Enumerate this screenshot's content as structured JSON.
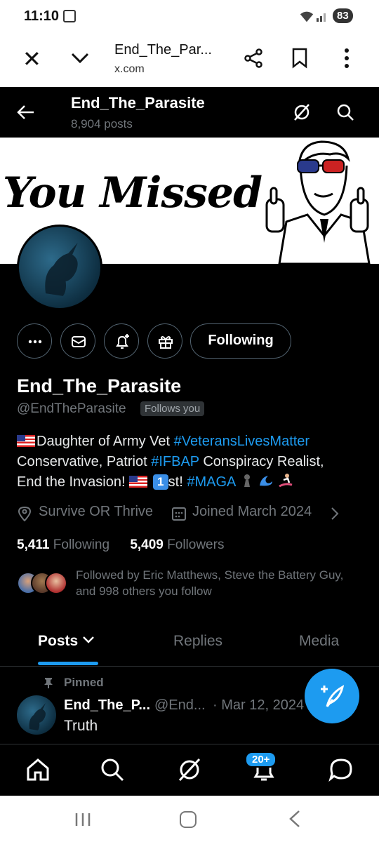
{
  "status_bar": {
    "time": "11:10",
    "battery": "83"
  },
  "browser": {
    "page_title": "End_The_Par...",
    "url": "x.com"
  },
  "header": {
    "name": "End_The_Parasite",
    "posts_count": "8,904 posts"
  },
  "banner": {
    "text": "You Missed"
  },
  "actions": {
    "following_label": "Following"
  },
  "profile": {
    "display_name": "End_The_Parasite",
    "handle": "@EndTheParasite",
    "follows_you": "Follows you",
    "bio": {
      "line1_text": "Daughter of Army Vet ",
      "line1_tag": "#VeteransLivesMatter",
      "line2_text": "Conservative, Patriot ",
      "line2_tag": "#IFBAP",
      "line2_text_b": " Conspiracy Realist,",
      "line3_text": "End the Invasion! ",
      "line3_keycap": "1",
      "line3_text_b": "st! ",
      "line3_tag": "#MAGA"
    },
    "location": "Survive OR Thrive",
    "joined": "Joined March 2024",
    "following_count": "5,411",
    "following_label": "Following",
    "followers_count": "5,409",
    "followers_label": "Followers",
    "followed_by": "Followed by Eric Matthews, Steve the Battery Guy, and 998 others you follow"
  },
  "tabs": [
    {
      "label": "Posts"
    },
    {
      "label": "Replies"
    },
    {
      "label": "Media"
    }
  ],
  "pinned_post": {
    "pinned_label": "Pinned",
    "name": "End_The_P...",
    "handle": "@End...",
    "date": "· Mar 12, 2024",
    "text": "Truth"
  },
  "bottom_nav": {
    "notification_badge": "20+"
  },
  "colors": {
    "accent": "#1d9bf0",
    "background": "#000000",
    "muted": "#71767b"
  }
}
